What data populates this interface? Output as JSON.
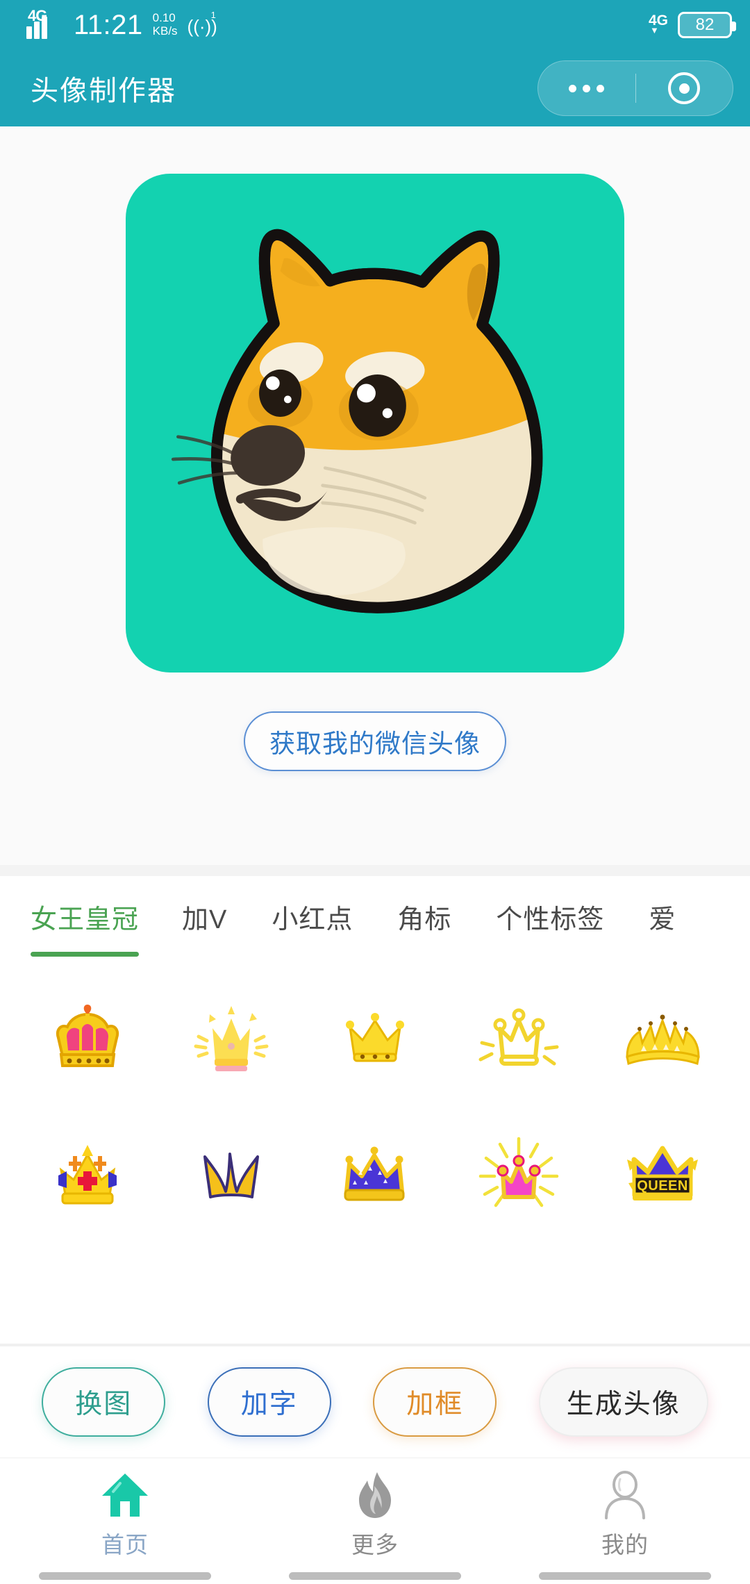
{
  "status_bar": {
    "network_type": "4G",
    "time": "11:21",
    "net_speed_value": "0.10",
    "net_speed_unit": "KB/s",
    "hotspot_badge": "1",
    "right_network": "4G",
    "battery_level": "82"
  },
  "nav": {
    "title": "头像制作器",
    "more_icon": "more-dots-icon",
    "capsule_icon": "target-circle-icon"
  },
  "preview": {
    "avatar_alt": "doge-shiba-avatar",
    "avatar_bg_color": "#13D2B0",
    "get_avatar_label": "获取我的微信头像"
  },
  "tabs": {
    "active_index": 0,
    "items": [
      {
        "label": "女王皇冠"
      },
      {
        "label": "加V"
      },
      {
        "label": "小红点"
      },
      {
        "label": "角标"
      },
      {
        "label": "个性标签"
      },
      {
        "label": "爱"
      }
    ]
  },
  "stickers": {
    "items": [
      {
        "name": "royal-gold-crown-pink-jewels"
      },
      {
        "name": "yellow-crown-with-sparkles"
      },
      {
        "name": "small-gold-crown-dots"
      },
      {
        "name": "outline-crown-with-rays"
      },
      {
        "name": "wide-tiara-crown"
      },
      {
        "name": "gold-crown-red-cross-jewel"
      },
      {
        "name": "simple-three-point-crown"
      },
      {
        "name": "purple-crown-gold-trim"
      },
      {
        "name": "pink-crown-burst-rays"
      },
      {
        "name": "queen-banner-crown"
      }
    ]
  },
  "actions": {
    "buttons": [
      {
        "label": "换图",
        "style": "teal"
      },
      {
        "label": "加字",
        "style": "blue"
      },
      {
        "label": "加框",
        "style": "orange"
      },
      {
        "label": "生成头像",
        "style": "plain"
      }
    ]
  },
  "tabbar": {
    "active_index": 0,
    "items": [
      {
        "label": "首页",
        "icon": "home-icon"
      },
      {
        "label": "更多",
        "icon": "fire-icon"
      },
      {
        "label": "我的",
        "icon": "person-icon"
      }
    ]
  },
  "colors": {
    "header_teal": "#1DA5B8",
    "avatar_teal": "#13D2B0",
    "tab_active_green": "#4AA352",
    "link_blue": "#2F79C8",
    "home_icon_teal": "#19C8A8"
  }
}
